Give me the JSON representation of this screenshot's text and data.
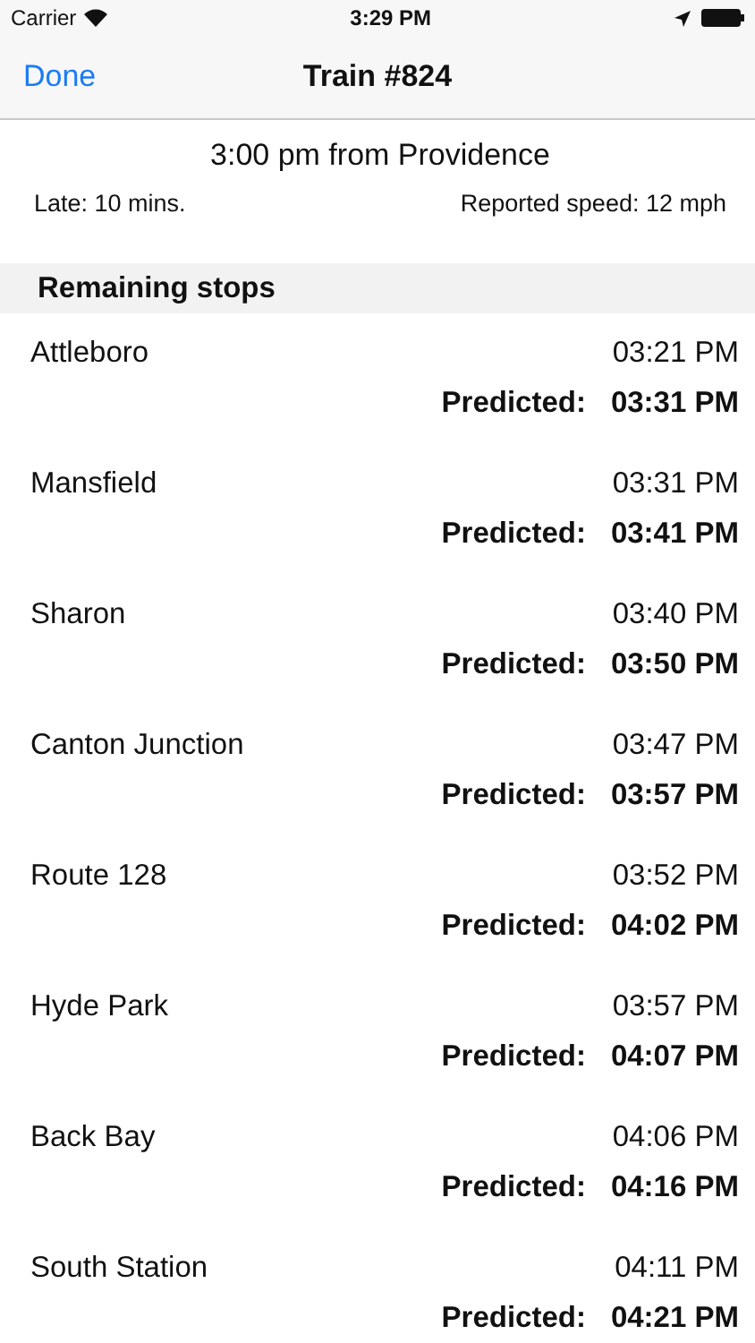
{
  "status_bar": {
    "carrier": "Carrier",
    "time": "3:29 PM"
  },
  "nav": {
    "back": "Done",
    "title": "Train #824"
  },
  "summary": {
    "departure": "3:00 pm from Providence",
    "late": "Late: 10 mins.",
    "speed": "Reported speed: 12 mph"
  },
  "section": {
    "title": "Remaining stops"
  },
  "stops": [
    {
      "name": "Attleboro",
      "scheduled": "03:21 PM",
      "predicted_label": "Predicted:",
      "predicted": "03:31 PM"
    },
    {
      "name": "Mansfield",
      "scheduled": "03:31 PM",
      "predicted_label": "Predicted:",
      "predicted": "03:41 PM"
    },
    {
      "name": "Sharon",
      "scheduled": "03:40 PM",
      "predicted_label": "Predicted:",
      "predicted": "03:50 PM"
    },
    {
      "name": "Canton Junction",
      "scheduled": "03:47 PM",
      "predicted_label": "Predicted:",
      "predicted": "03:57 PM"
    },
    {
      "name": "Route 128",
      "scheduled": "03:52 PM",
      "predicted_label": "Predicted:",
      "predicted": "04:02 PM"
    },
    {
      "name": "Hyde Park",
      "scheduled": "03:57 PM",
      "predicted_label": "Predicted:",
      "predicted": "04:07 PM"
    },
    {
      "name": "Back Bay",
      "scheduled": "04:06 PM",
      "predicted_label": "Predicted:",
      "predicted": "04:16 PM"
    },
    {
      "name": "South Station",
      "scheduled": "04:11 PM",
      "predicted_label": "Predicted:",
      "predicted": "04:21 PM"
    }
  ]
}
